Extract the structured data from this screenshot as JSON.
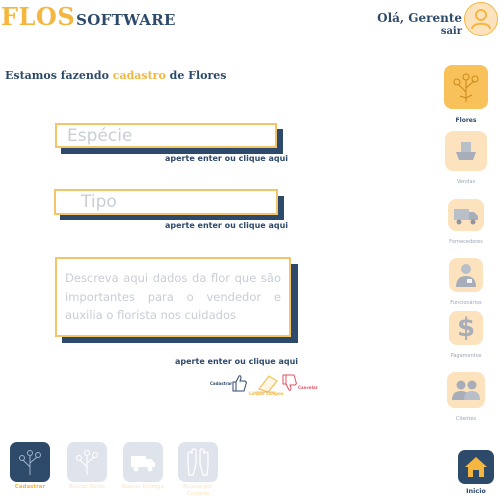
{
  "header": {
    "logo_primary": "FLOS",
    "logo_secondary": "SOFTWARE",
    "greeting": "Olá, Gerente",
    "logout": "sair"
  },
  "page": {
    "heading_before": "Estamos fazendo ",
    "heading_highlight": "cadastro",
    "heading_after": " de Flores"
  },
  "form": {
    "species": {
      "placeholder": "Espécie",
      "hint": "aperte enter ou clique aqui"
    },
    "type": {
      "placeholder": "Tipo",
      "hint": "aperte enter ou clique aqui"
    },
    "description": {
      "placeholder": "Descreva aqui dados da flor que são importantes para o vendedor e auxilia o florista nos cuidados",
      "hint": "aperte enter ou clique aqui"
    },
    "actions": [
      {
        "label": "Cadastrar",
        "icon": "thumbs-up-icon",
        "color": "#2e4a6b"
      },
      {
        "label": "Limpar campos",
        "icon": "eraser-icon",
        "color": "#f4b63f"
      },
      {
        "label": "Cancelar",
        "icon": "thumbs-down-icon",
        "color": "#e05260"
      }
    ]
  },
  "sidebar": {
    "items": [
      {
        "label": "Flores",
        "icon": "flower-icon",
        "active": true
      },
      {
        "label": "Vendas",
        "icon": "cart-icon",
        "active": false
      },
      {
        "label": "Fornecedores",
        "icon": "truck-icon",
        "active": false
      },
      {
        "label": "Funcionários",
        "icon": "employee-icon",
        "active": false
      },
      {
        "label": "Pagamentos",
        "icon": "dollar-icon",
        "active": false
      },
      {
        "label": "Clientes",
        "icon": "clients-icon",
        "active": false
      }
    ]
  },
  "bottom": {
    "items": [
      {
        "label": "Cadastrar",
        "icon": "flower-icon",
        "active": true
      },
      {
        "label": "Buscar flores",
        "icon": "flower-icon",
        "active": false
      },
      {
        "label": "Buscar Entrega",
        "icon": "truck-icon",
        "active": false
      },
      {
        "label": "Buscar por Cuidado",
        "icon": "gloves-icon",
        "active": false
      }
    ],
    "home": {
      "label": "Inicio",
      "icon": "home-icon"
    }
  },
  "colors": {
    "accent": "#f4b63f",
    "primary": "#2e4a6b",
    "tile_light": "#fde3bd",
    "danger": "#e05260"
  }
}
